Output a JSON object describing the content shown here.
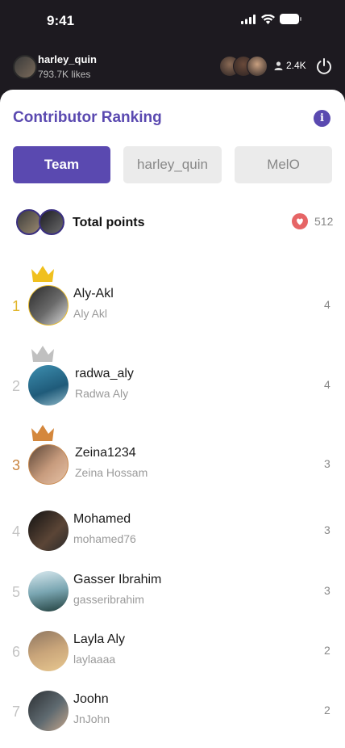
{
  "status": {
    "time": "9:41"
  },
  "header": {
    "host_name": "harley_quin",
    "host_likes": "793.7K likes",
    "viewer_count": "2.4K",
    "viewer_avatar_colors": [
      "#8a6a55",
      "#6a4a3a",
      "#c9a080"
    ]
  },
  "sheet": {
    "title": "Contributor Ranking",
    "tabs": [
      "Team",
      "harley_quin",
      "MelO"
    ],
    "total_label": "Total points",
    "total_value": "512"
  },
  "rows": [
    {
      "rank": "1",
      "username": "Aly-Akl",
      "display": "Aly Akl",
      "score": "4",
      "crown": "#f0c01e",
      "border": "#e8bd2e",
      "avatar": "linear-gradient(135deg,#2a2a2a,#6b6b6b 55%,#d9d9d9)"
    },
    {
      "rank": "2",
      "username": "radwa_aly",
      "display": "Radwa Aly",
      "score": "4",
      "crown": "#c0c0c0",
      "border": "transparent",
      "avatar": "linear-gradient(160deg,#3d8fb0,#1f5b7a 60%,#8fb8c8)"
    },
    {
      "rank": "3",
      "username": "Zeina1234",
      "display": "Zeina Hossam",
      "score": "3",
      "crown": "#d4873c",
      "border": "#c98a4f",
      "avatar": "linear-gradient(135deg,#5a4536,#c79b7d 55%,#e6c2a6)"
    },
    {
      "rank": "4",
      "username": "Mohamed",
      "display": "mohamed76",
      "score": "3",
      "avatar": "linear-gradient(135deg,#111,#5b4536 60%,#2a2a2a)"
    },
    {
      "rank": "5",
      "username": "Gasser Ibrahim",
      "display": "gasseribrahim",
      "score": "3",
      "avatar": "linear-gradient(170deg,#d8e8ee,#7aa6b2 50%,#22403e)"
    },
    {
      "rank": "6",
      "username": "Layla Aly",
      "display": "laylaaaa",
      "score": "2",
      "avatar": "linear-gradient(160deg,#8d7560,#c9a57a 50%,#e8c890)"
    },
    {
      "rank": "7",
      "username": "Joohn",
      "display": "JnJohn",
      "score": "2",
      "avatar": "linear-gradient(135deg,#2b2f33,#5f6a70 55%,#c4a68c)"
    }
  ]
}
